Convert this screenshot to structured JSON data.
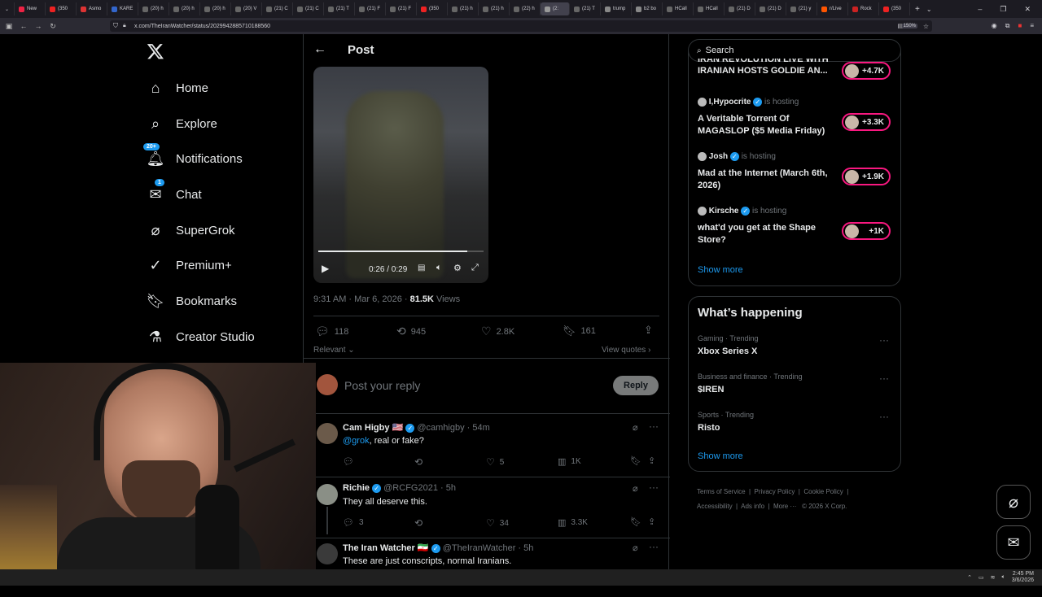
{
  "browser": {
    "tabs": [
      {
        "label": "New",
        "color": "#e24"
      },
      {
        "label": "(350",
        "color": "#e22"
      },
      {
        "label": "Asmo",
        "color": "#d33"
      },
      {
        "label": "KARE",
        "color": "#36c"
      },
      {
        "label": "(20) h",
        "color": "#666"
      },
      {
        "label": "(20) h",
        "color": "#666"
      },
      {
        "label": "(20) h",
        "color": "#666"
      },
      {
        "label": "(20) V",
        "color": "#666"
      },
      {
        "label": "(21) C",
        "color": "#666"
      },
      {
        "label": "(21) C",
        "color": "#666"
      },
      {
        "label": "(21) T",
        "color": "#666"
      },
      {
        "label": "(21) F",
        "color": "#666"
      },
      {
        "label": "(21) F",
        "color": "#666"
      },
      {
        "label": "(350",
        "color": "#e22"
      },
      {
        "label": "(21) h",
        "color": "#666"
      },
      {
        "label": "(21) h",
        "color": "#666"
      },
      {
        "label": "(22) h",
        "color": "#666"
      },
      {
        "label": "(2:",
        "color": "#999"
      },
      {
        "label": "(21) T",
        "color": "#666"
      },
      {
        "label": "trump",
        "color": "#888"
      },
      {
        "label": "b2 bo",
        "color": "#888"
      },
      {
        "label": "HCall",
        "color": "#666"
      },
      {
        "label": "HCall",
        "color": "#666"
      },
      {
        "label": "(21) D",
        "color": "#666"
      },
      {
        "label": "(21) D",
        "color": "#666"
      },
      {
        "label": "(21) y",
        "color": "#666"
      },
      {
        "label": "r/Live",
        "color": "#f50"
      },
      {
        "label": "Rock",
        "color": "#c22"
      },
      {
        "label": "(350",
        "color": "#e22"
      }
    ],
    "url": "x.com/TheIranWatcher/status/2029942885710188560",
    "zoom": "150%"
  },
  "nav": {
    "items": [
      {
        "label": "Home",
        "icon": "home-icon"
      },
      {
        "label": "Explore",
        "icon": "search-icon"
      },
      {
        "label": "Notifications",
        "icon": "bell-icon",
        "badge": "20+"
      },
      {
        "label": "Chat",
        "icon": "mail-icon",
        "badge": "1"
      },
      {
        "label": "SuperGrok",
        "icon": "grok-icon"
      },
      {
        "label": "Premium+",
        "icon": "premium-icon"
      },
      {
        "label": "Bookmarks",
        "icon": "bookmark-icon"
      },
      {
        "label": "Creator Studio",
        "icon": "flask-icon"
      }
    ]
  },
  "post": {
    "header": "Post",
    "video": {
      "time": "0:26 / 0:29",
      "progress": 0.9
    },
    "timestamp": "9:31 AM · Mar 6, 2026 · ",
    "views": "81.5K",
    "views_label": " Views",
    "actions": {
      "replies": "118",
      "reposts": "945",
      "likes": "2.8K",
      "bookmarks": "161"
    },
    "sort": "Relevant",
    "view_quotes": "View quotes",
    "reply_placeholder": "Post your reply",
    "reply_button": "Reply"
  },
  "replies": [
    {
      "name": "Cam Higby",
      "flag": "🇺🇸",
      "handle": "@camhigby",
      "time": "· 54m",
      "mention": "@grok",
      "text": ", real or fake?",
      "replies": "",
      "likes": "5",
      "views": "1K",
      "avatar_color": "#6b5a4a"
    },
    {
      "name": "Richie",
      "flag": "",
      "handle": "@RCFG2021",
      "time": "· 5h",
      "mention": "",
      "text": "They all deserve this.",
      "replies": "3",
      "likes": "34",
      "views": "3.3K",
      "avatar_color": "#8a8f86"
    },
    {
      "name": "The Iran Watcher",
      "flag": "🇮🇷",
      "handle": "@TheIranWatcher",
      "time": "· 5h",
      "mention": "",
      "text": "These are just conscripts, normal Iranians.",
      "replies": "",
      "likes": "",
      "views": "",
      "avatar_color": "#3a3a3a"
    }
  ],
  "right": {
    "search_placeholder": "Search",
    "live": [
      {
        "host": "",
        "title": "IRANIAN HOSTS GOLDIE AN...",
        "title_top": "IRAN REVOLUTION LIVE WITH",
        "count": "+4.7K"
      },
      {
        "host": "I,Hypocrite",
        "hosting": "is hosting",
        "title": "A Veritable Torrent Of MAGASLOP ($5 Media Friday)",
        "count": "+3.3K"
      },
      {
        "host": "Josh",
        "hosting": "is hosting",
        "title": "Mad at the Internet (March 6th, 2026)",
        "count": "+1.9K"
      },
      {
        "host": "Kirsche",
        "hosting": "is hosting",
        "title": "what'd you get at the Shape Store?",
        "count": "+1K"
      }
    ],
    "show_more": "Show more",
    "happening_title": "What’s happening",
    "trends": [
      {
        "meta": "Gaming · Trending",
        "name": "Xbox Series X"
      },
      {
        "meta": "Business and finance · Trending",
        "name": "$IREN"
      },
      {
        "meta": "Sports · Trending",
        "name": "Risto"
      }
    ],
    "show_more2": "Show more",
    "footer": [
      "Terms of Service",
      "Privacy Policy",
      "Cookie Policy",
      "Accessibility",
      "Ads info",
      "More ···",
      "© 2026 X Corp."
    ]
  },
  "taskbar": {
    "time": "2:45 PM",
    "date": "3/6/2026"
  }
}
